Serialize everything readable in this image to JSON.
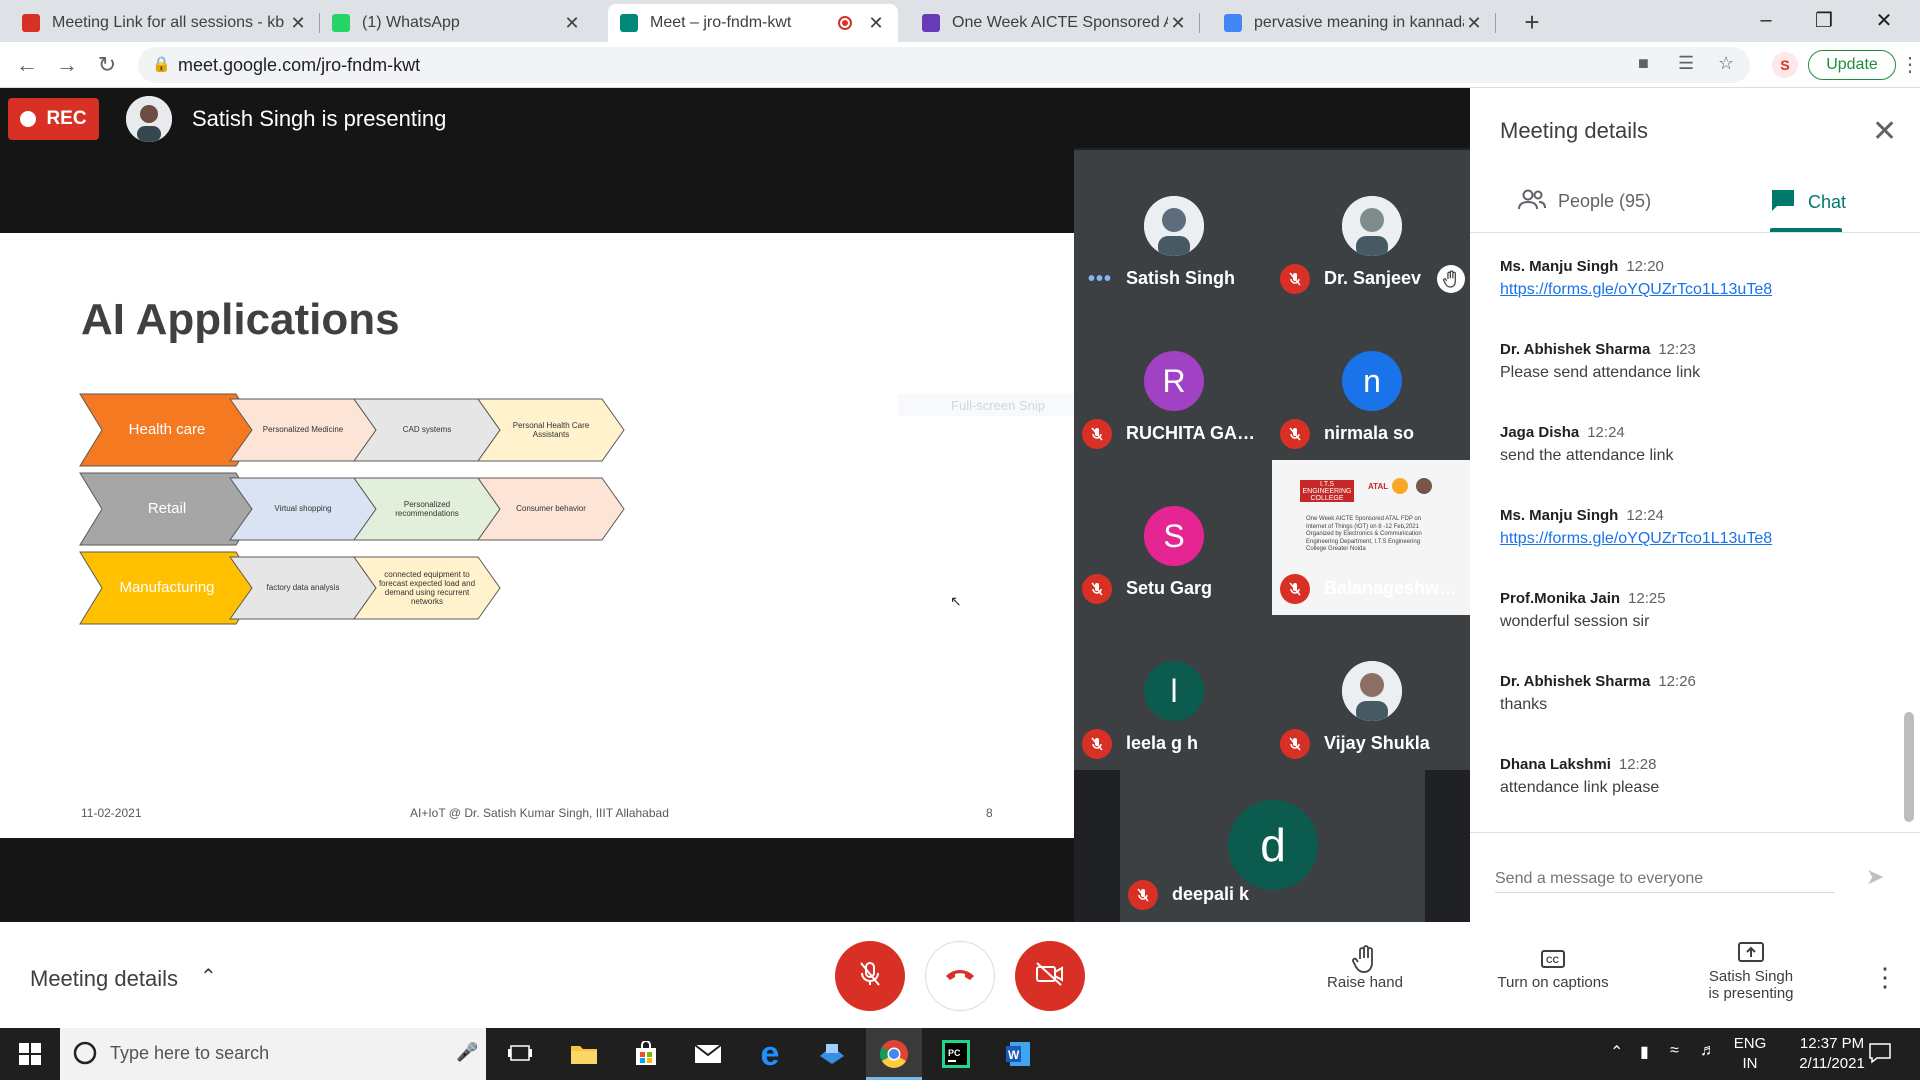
{
  "browser": {
    "tabs": [
      {
        "title": "Meeting Link for all sessions - kb",
        "icon": "gmail-icon",
        "color": "#d93025"
      },
      {
        "title": "(1) WhatsApp",
        "icon": "whatsapp-icon",
        "color": "#25d366"
      },
      {
        "title": "Meet – jro-fndm-kwt",
        "icon": "meet-icon",
        "color": "#00897b"
      },
      {
        "title": "One Week AICTE Sponsored ATAL",
        "icon": "forms-icon",
        "color": "#673ab7"
      },
      {
        "title": "pervasive meaning in kannada -",
        "icon": "google-icon",
        "color": "#4285f4"
      }
    ],
    "new_tab": "+",
    "url": "meet.google.com/jro-fndm-kwt",
    "update_label": "Update"
  },
  "meet": {
    "rec_label": "REC",
    "presenting_text": "Satish Singh is presenting",
    "slide": {
      "title": "AI Applications",
      "rows": [
        {
          "main": "Health care",
          "items": [
            "Personalized Medicine",
            "CAD systems",
            "Personal Health Care Assistants"
          ]
        },
        {
          "main": "Retail",
          "items": [
            "Virtual shopping",
            "Personalized recommendations",
            "Consumer behavior"
          ]
        },
        {
          "main": "Manufacturing",
          "items": [
            "factory data analysis",
            "connected equipment to forecast expected load and demand using recurrent networks"
          ]
        }
      ],
      "footer_date": "11-02-2021",
      "footer_center": "AI+IoT @ Dr. Satish Kumar Singh, IIIT Allahabad",
      "footer_page": "8"
    },
    "snip_label": "Full-screen Snip",
    "participants": [
      {
        "name": "Satish Singh",
        "avatar": "photo",
        "color": "#5d6d7e"
      },
      {
        "name": "Dr. Sanjeev",
        "avatar": "photo",
        "color": "#7f8c8d"
      },
      {
        "name": "RUCHITA GAUT...",
        "avatar": "R",
        "color": "#a142c4"
      },
      {
        "name": "nirmala so",
        "avatar": "n",
        "color": "#1a73e8"
      },
      {
        "name": "Setu Garg",
        "avatar": "S",
        "color": "#e52592"
      },
      {
        "name": "Balanageshwar...",
        "avatar": "video",
        "color": "#f5f5f5"
      },
      {
        "name": "leela g h",
        "avatar": "l",
        "color": "#0b5c4e"
      },
      {
        "name": "Vijay Shukla",
        "avatar": "photo",
        "color": "#8d6e63"
      },
      {
        "name": "deepali k",
        "avatar": "d",
        "color": "#0b5c4e"
      }
    ],
    "video_thumb": {
      "college": "I.T.S ENGINEERING COLLEGE",
      "badge": "ATAL",
      "caption": "One Week AICTE Sponsored ATAL FDP on Internet of Things (IOT) on 8 -12 Feb,2021 Organized by Electronics & Communication Engineering Department, I.T.S Engineering College Greater Noida"
    }
  },
  "panel": {
    "title": "Meeting details",
    "tab_people": "People (95)",
    "tab_chat": "Chat",
    "messages": [
      {
        "sender": "Ms. Manju Singh",
        "time": "12:20",
        "text": "https://forms.gle/oYQUZrTco1L13uTe8",
        "link": true
      },
      {
        "sender": "Dr. Abhishek Sharma",
        "time": "12:23",
        "text": "Please send attendance link",
        "link": false
      },
      {
        "sender": "Jaga Disha",
        "time": "12:24",
        "text": "send the attendance link",
        "link": false
      },
      {
        "sender": "Ms. Manju Singh",
        "time": "12:24",
        "text": "https://forms.gle/oYQUZrTco1L13uTe8",
        "link": true
      },
      {
        "sender": "Prof.Monika Jain",
        "time": "12:25",
        "text": "wonderful session sir",
        "link": false
      },
      {
        "sender": "Dr. Abhishek Sharma",
        "time": "12:26",
        "text": "thanks",
        "link": false
      },
      {
        "sender": "Dhana Lakshmi",
        "time": "12:28",
        "text": "attendance link please",
        "link": false
      }
    ],
    "input_placeholder": "Send a message to everyone"
  },
  "bottombar": {
    "meeting_details": "Meeting details",
    "raise_hand": "Raise hand",
    "captions": "Turn on captions",
    "presenting_line1": "Satish Singh",
    "presenting_line2": "is presenting"
  },
  "taskbar": {
    "search_placeholder": "Type here to search",
    "lang1": "ENG",
    "lang2": "IN",
    "time": "12:37 PM",
    "date": "2/11/2021"
  }
}
